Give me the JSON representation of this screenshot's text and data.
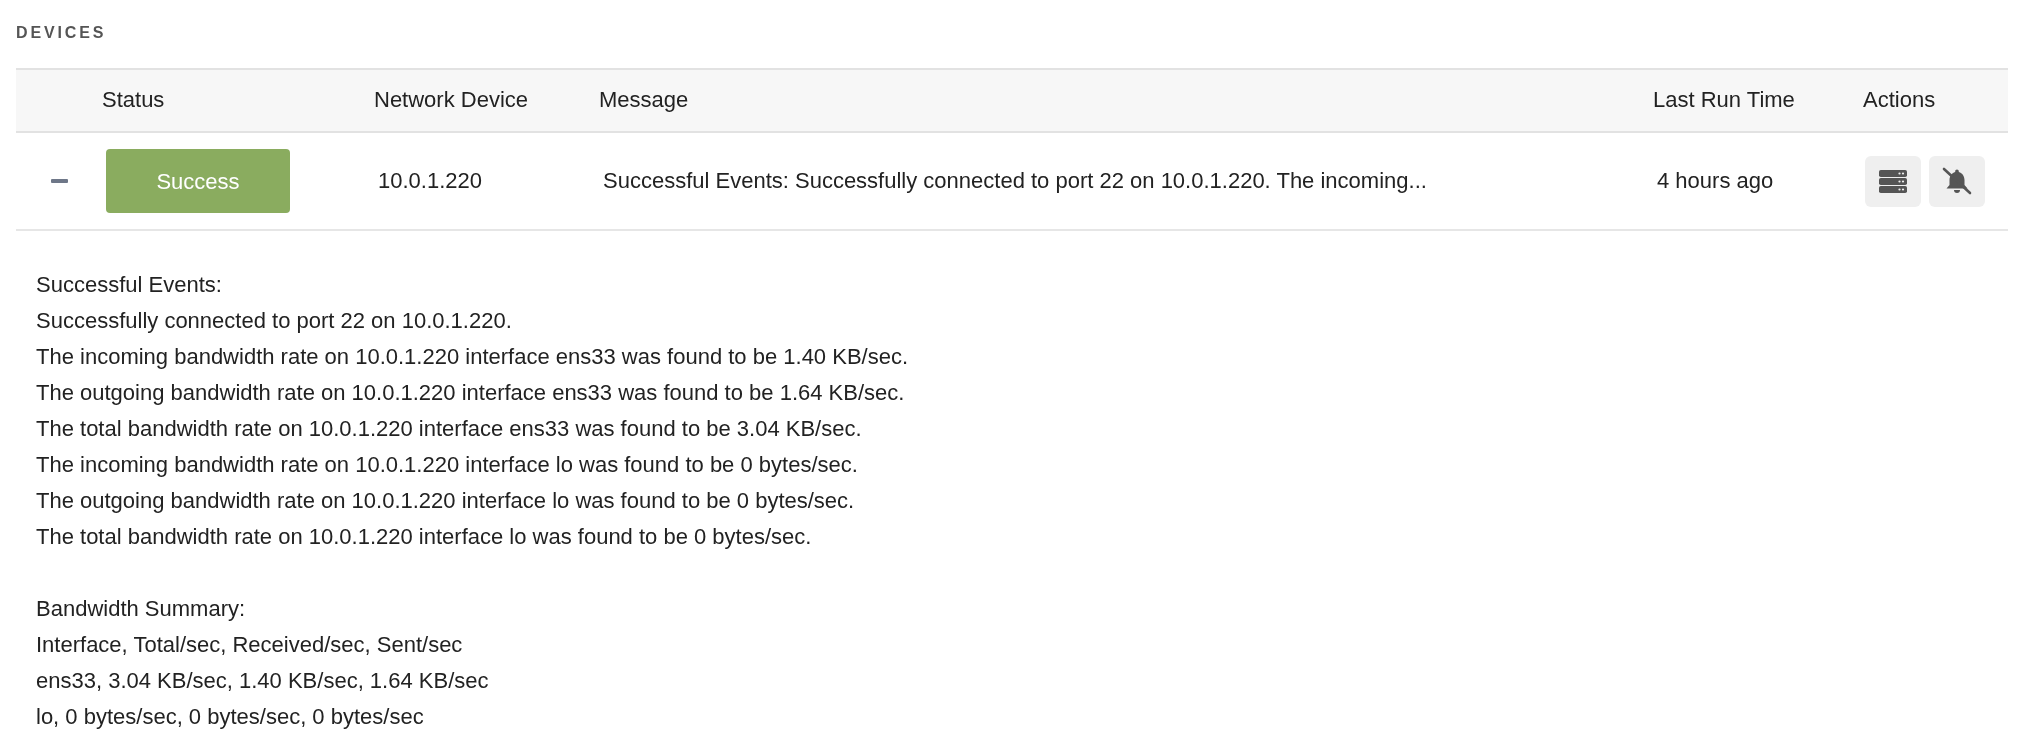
{
  "section_title": "DEVICES",
  "table": {
    "columns": [
      "Status",
      "Network Device",
      "Message",
      "Last Run Time",
      "Actions"
    ],
    "rows": [
      {
        "expanded": true,
        "status": {
          "label": "Success",
          "color": "#8aac5f"
        },
        "network_device": "10.0.1.220",
        "message": "Successful Events: Successfully connected to port 22 on 10.0.1.220. The incoming...",
        "last_run_time": "4 hours ago",
        "details": [
          [
            "Successful Events:",
            "Successfully connected to port 22 on 10.0.1.220.",
            "The incoming bandwidth rate on 10.0.1.220 interface ens33 was found to be 1.40 KB/sec.",
            "The outgoing bandwidth rate on 10.0.1.220 interface ens33 was found to be 1.64 KB/sec.",
            "The total bandwidth rate on 10.0.1.220 interface ens33 was found to be 3.04 KB/sec.",
            "The incoming bandwidth rate on 10.0.1.220 interface lo was found to be 0 bytes/sec.",
            "The outgoing bandwidth rate on 10.0.1.220 interface lo was found to be 0 bytes/sec.",
            "The total bandwidth rate on 10.0.1.220 interface lo was found to be 0 bytes/sec."
          ],
          [
            "Bandwidth Summary:",
            "Interface, Total/sec, Received/sec, Sent/sec",
            "ens33, 3.04 KB/sec, 1.40 KB/sec, 1.64 KB/sec",
            "lo, 0 bytes/sec, 0 bytes/sec, 0 bytes/sec"
          ]
        ]
      }
    ]
  }
}
